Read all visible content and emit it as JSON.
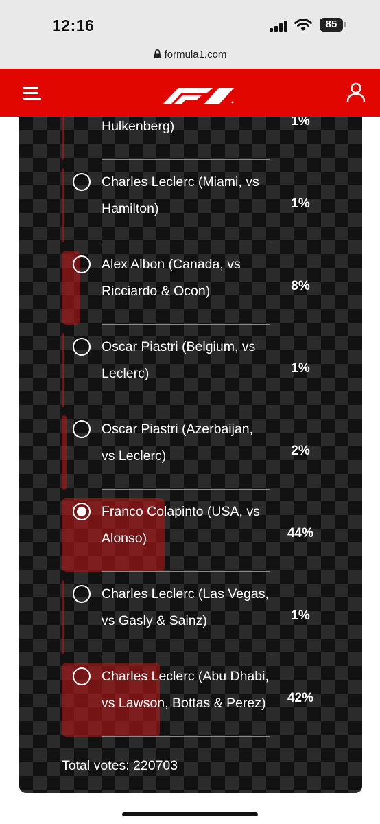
{
  "status_bar": {
    "time": "12:16",
    "battery": "85"
  },
  "browser": {
    "url": "formula1.com"
  },
  "header": {
    "logo_icon": "f1-logo",
    "menu_icon": "hamburger-menu-icon",
    "user_icon": "user-icon",
    "brand_color": "#e10600"
  },
  "poll": {
    "options": [
      {
        "label_line1": "",
        "label_line2": "Hulkenberg)",
        "percent_text": "1%",
        "percent": 1,
        "selected": false
      },
      {
        "label_line1": "Charles Leclerc (Miami, vs",
        "label_line2": "Hamilton)",
        "percent_text": "1%",
        "percent": 1,
        "selected": false
      },
      {
        "label_line1": "Alex Albon (Canada, vs",
        "label_line2": "Ricciardo & Ocon)",
        "percent_text": "8%",
        "percent": 8,
        "selected": false
      },
      {
        "label_line1": "Oscar Piastri (Belgium, vs",
        "label_line2": "Leclerc)",
        "percent_text": "1%",
        "percent": 1,
        "selected": false
      },
      {
        "label_line1": "Oscar Piastri (Azerbaijan,",
        "label_line2": "vs Leclerc)",
        "percent_text": "2%",
        "percent": 2,
        "selected": false
      },
      {
        "label_line1": "Franco Colapinto (USA, vs",
        "label_line2": "Alonso)",
        "percent_text": "44%",
        "percent": 44,
        "selected": true
      },
      {
        "label_line1": "Charles Leclerc (Las Vegas,",
        "label_line2": "vs Gasly & Sainz)",
        "percent_text": "1%",
        "percent": 1,
        "selected": false
      },
      {
        "label_line1": "Charles Leclerc (Abu Dhabi,",
        "label_line2": "vs Lawson, Bottas & Perez)",
        "percent_text": "42%",
        "percent": 42,
        "selected": false
      }
    ],
    "total_votes": "Total votes: 220703"
  }
}
